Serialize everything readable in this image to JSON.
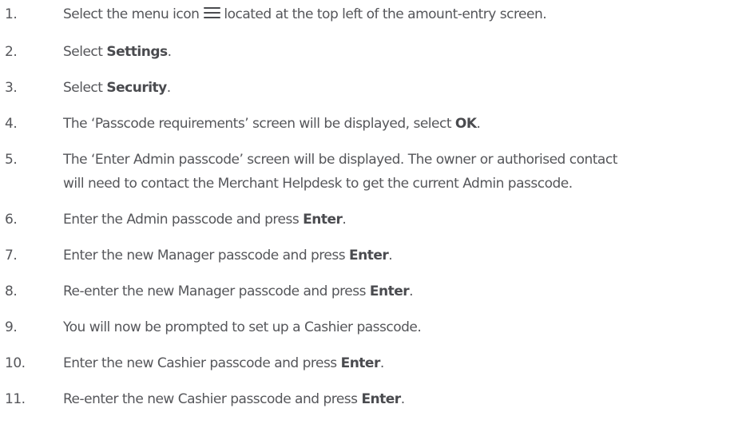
{
  "steps": [
    {
      "num": "1.",
      "pre": "Select the menu icon",
      "icon": "menu-icon",
      "post": "located at the top left of the amount-entry screen."
    },
    {
      "num": "2.",
      "pre": "Select ",
      "bold": "Settings",
      "post": "."
    },
    {
      "num": "3.",
      "pre": "Select ",
      "bold": "Security",
      "post": "."
    },
    {
      "num": "4.",
      "pre": "The ‘Passcode requirements’ screen will be displayed, select ",
      "bold": "OK",
      "post": "."
    },
    {
      "num": "5.",
      "line1": "The ‘Enter Admin passcode’ screen will be displayed. The owner or authorised contact",
      "line2": "will need to contact the Merchant Helpdesk to get the current Admin passcode."
    },
    {
      "num": "6.",
      "pre": "Enter the Admin passcode and press ",
      "bold": "Enter",
      "post": "."
    },
    {
      "num": "7.",
      "pre": "Enter the new Manager passcode and press ",
      "bold": "Enter",
      "post": "."
    },
    {
      "num": "8.",
      "pre": "Re-enter the new Manager passcode and press ",
      "bold": "Enter",
      "post": "."
    },
    {
      "num": "9.",
      "text": "You will now be prompted to set up a Cashier passcode."
    },
    {
      "num": "10.",
      "pre": "Enter the new Cashier passcode and press ",
      "bold": "Enter",
      "post": "."
    },
    {
      "num": "11.",
      "pre": "Re-enter the new Cashier passcode and press ",
      "bold": "Enter",
      "post": "."
    }
  ]
}
